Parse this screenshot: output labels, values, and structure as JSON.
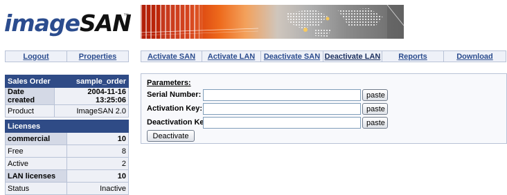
{
  "logo": {
    "image_text": "image",
    "san_text": "SAN",
    "trademark": "™"
  },
  "left_nav": [
    {
      "label": "Logout"
    },
    {
      "label": "Properties"
    }
  ],
  "top_nav": [
    {
      "label": "Activate SAN"
    },
    {
      "label": "Activate LAN"
    },
    {
      "label": "Deactivate SAN"
    },
    {
      "label": "Deactivate LAN"
    },
    {
      "label": "Reports"
    },
    {
      "label": "Download"
    }
  ],
  "order": {
    "header_label": "Sales Order",
    "header_value": "sample_order",
    "rows": [
      {
        "label": "Date created",
        "value": "2004-11-16 13:25:06"
      },
      {
        "label": "Product",
        "value": "ImageSAN 2.0"
      }
    ]
  },
  "licenses": {
    "header": "Licenses",
    "commercial": {
      "label": "commercial",
      "value": "10"
    },
    "free": {
      "label": "Free",
      "value": "8"
    },
    "active": {
      "label": "Active",
      "value": "2"
    },
    "lan": {
      "label": "LAN licenses",
      "value": "10"
    },
    "status": {
      "label": "Status",
      "value": "Inactive"
    }
  },
  "params": {
    "title": "Parameters:",
    "fields": [
      {
        "label": "Serial Number:",
        "value": "",
        "button": "paste"
      },
      {
        "label": "Activation Key:",
        "value": "",
        "button": "paste"
      },
      {
        "label": "Deactivation Key:",
        "value": "",
        "button": "paste"
      }
    ],
    "submit": "Deactivate"
  },
  "colors": {
    "brand_blue": "#2b4c8e",
    "header_bg": "#2f4b86",
    "nav_bg": "#eef1f8"
  }
}
